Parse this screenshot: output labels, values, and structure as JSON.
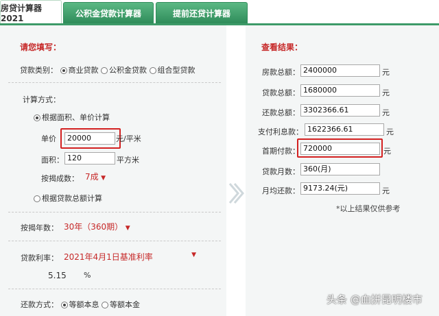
{
  "tabs": [
    {
      "label": "房贷计算器2021",
      "active": true
    },
    {
      "label": "公积金贷款计算器",
      "active": false
    },
    {
      "label": "提前还贷计算器",
      "active": false
    }
  ],
  "left": {
    "title": "请您填写：",
    "loan_type": {
      "label": "贷款类别：",
      "options": [
        "商业贷款",
        "公积金贷款",
        "组合型贷款"
      ],
      "selected": 0
    },
    "calc_method": {
      "label": "计算方式：",
      "option1": "根据面积、单价计算",
      "unit_price_label": "单价",
      "unit_price_value": "20000",
      "unit_price_unit": "元/平米",
      "area_label": "面积：",
      "area_value": "120",
      "area_unit": "平方米",
      "ratio_label": "按揭成数：",
      "ratio_value": "7成",
      "option2": "根据贷款总额计算"
    },
    "years": {
      "label": "按揭年数：",
      "value": "30年（360期）"
    },
    "rate": {
      "label": "贷款利率：",
      "value": "2021年4月1日基准利率",
      "number": "5.15",
      "unit": "%"
    },
    "repay": {
      "label": "还款方式：",
      "options": [
        "等额本息",
        "等额本金"
      ],
      "selected": 0
    }
  },
  "right": {
    "title": "查看结果：",
    "rows": [
      {
        "label": "房款总额：",
        "value": "2400000",
        "unit": "元"
      },
      {
        "label": "贷款总额：",
        "value": "1680000",
        "unit": "元"
      },
      {
        "label": "还款总额：",
        "value": "3302366.61",
        "unit": "元"
      },
      {
        "label": "支付利息款：",
        "value": "1622366.61",
        "unit": "元"
      },
      {
        "label": "首期付款：",
        "value": "720000",
        "unit": "元"
      },
      {
        "label": "贷款月数：",
        "value": "360(月)",
        "unit": ""
      },
      {
        "label": "月均还款：",
        "value": "9173.24(元)",
        "unit": "元"
      }
    ],
    "note": "*以上结果仅供参考"
  },
  "watermark": "头条 @血拼昆明楼市"
}
